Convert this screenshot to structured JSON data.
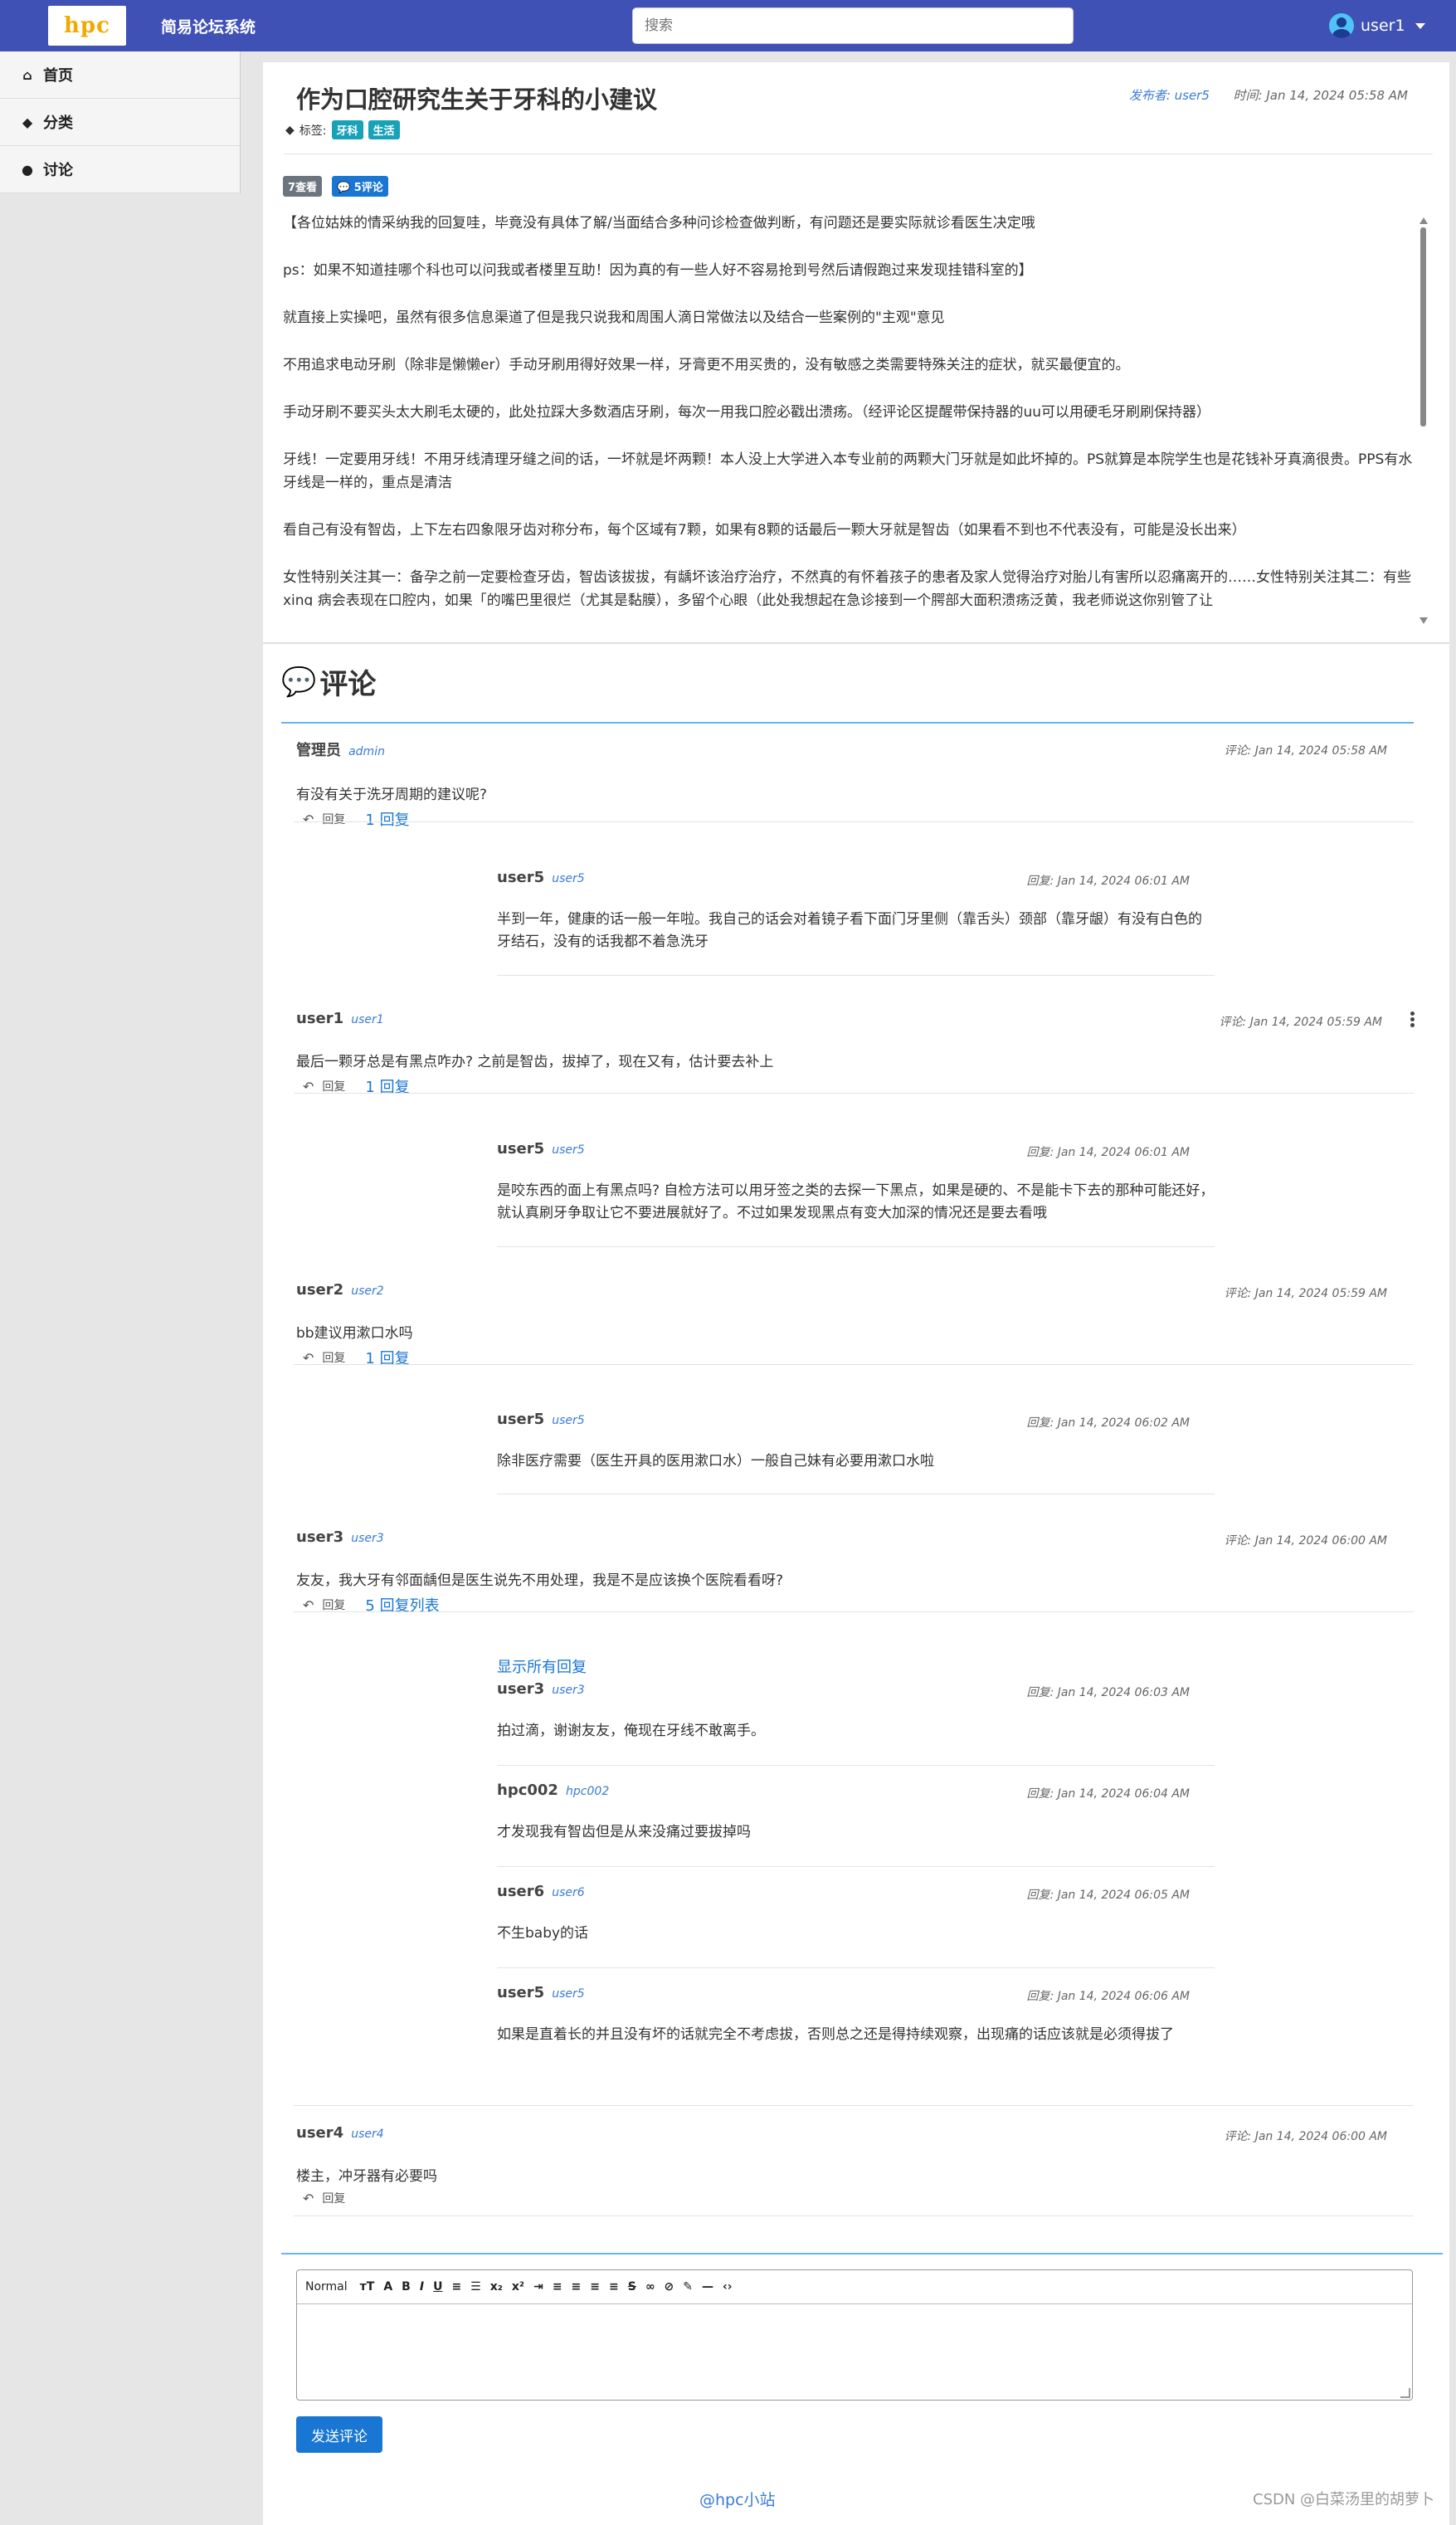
{
  "nav": {
    "logo_text": "hpc",
    "app_name": "简易论坛系统",
    "search_placeholder": "搜索",
    "user_name": "user1"
  },
  "sidebar": {
    "items": [
      {
        "label": "首页",
        "icon": "home-icon"
      },
      {
        "label": "分类",
        "icon": "tags-icon"
      },
      {
        "label": "讨论",
        "icon": "comment-icon"
      }
    ]
  },
  "post": {
    "title": "作为口腔研究生关于牙科的小建议",
    "publisher_label": "发布者: user5",
    "time_label": "时间: Jan 14, 2024 05:58 AM",
    "tags_label": "标签:",
    "tags": [
      "牙科",
      "生活"
    ],
    "views": "7查看",
    "comment_count": "5评论",
    "paragraphs": [
      "【各位姑妹的情采纳我的回复哇，毕竟没有具体了解/当面结合多种问诊检查做判断，有问题还是要实际就诊看医生决定哦",
      "ps：如果不知道挂哪个科也可以问我或者楼里互助！因为真的有一些人好不容易抢到号然后请假跑过来发现挂错科室的】",
      "就直接上实操吧，虽然有很多信息渠道了但是我只说我和周围人滴日常做法以及结合一些案例的\"主观\"意见",
      "不用追求电动牙刷（除非是懒懒er）手动牙刷用得好效果一样，牙膏更不用买贵的，没有敏感之类需要特殊关注的症状，就买最便宜的。",
      "手动牙刷不要买头太大刷毛太硬的，此处拉踩大多数酒店牙刷，每次一用我口腔必戳出溃疡。（经评论区提醒带保持器的uu可以用硬毛牙刷刷保持器）",
      "牙线！一定要用牙线！不用牙线清理牙缝之间的话，一坏就是坏两颗！本人没上大学进入本专业前的两颗大门牙就是如此坏掉的。PS就算是本院学生也是花钱补牙真滴很贵。PPS有水牙线是一样的，重点是清洁",
      "看自己有没有智齿，上下左右四象限牙齿对称分布，每个区域有7颗，如果有8颗的话最后一颗大牙就是智齿（如果看不到也不代表没有，可能是没长出来）",
      "女性特别关注其一：备孕之前一定要检查牙齿，智齿该拔拔，有龋坏该治疗治疗，不然真的有怀着孩子的患者及家人觉得治疗对胎儿有害所以忍痛离开的……女性特别关注其二：有些xing 病会表现在口腔内，如果「的嘴巴里很烂（尤其是黏膜），多留个心眼（此处我想起在急诊接到一个腭部大面积溃疡泛黄，我老师说这你别管了让"
    ]
  },
  "comments": {
    "heading": "评论",
    "time_prefix_top": "评论:",
    "reply_label": "回复",
    "items": [
      {
        "user": "管理员",
        "handle": "admin",
        "time": "评论: Jan 14, 2024 05:58 AM",
        "text": "有没有关于洗牙周期的建议呢?",
        "reply_count": "1 回复"
      },
      {
        "user": "user1",
        "handle": "user1",
        "time": "评论: Jan 14, 2024 05:59 AM",
        "text": "最后一颗牙总是有黑点咋办? 之前是智齿，拔掉了，现在又有，估计要去补上",
        "reply_count": "1 回复"
      },
      {
        "user": "user2",
        "handle": "user2",
        "time": "评论: Jan 14, 2024 05:59 AM",
        "text": "bb建议用漱口水吗",
        "reply_count": "1 回复"
      },
      {
        "user": "user3",
        "handle": "user3",
        "time": "评论: Jan 14, 2024 06:00 AM",
        "text": "友友，我大牙有邻面龋但是医生说先不用处理，我是不是应该换个医院看看呀?",
        "reply_count": "5 回复列表"
      },
      {
        "user": "user4",
        "handle": "user4",
        "time": "评论: Jan 14, 2024 06:00 AM",
        "text": "楼主，冲牙器有必要吗",
        "reply_count": ""
      }
    ],
    "replies": [
      {
        "user": "user5",
        "handle": "user5",
        "time": "回复: Jan 14, 2024 06:01 AM",
        "text": "半到一年，健康的话一般一年啦。我自己的话会对着镜子看下面门牙里侧（靠舌头）颈部（靠牙龈）有没有白色的牙结石，没有的话我都不着急洗牙"
      },
      {
        "user": "user5",
        "handle": "user5",
        "time": "回复: Jan 14, 2024 06:01 AM",
        "text": "是咬东西的面上有黑点吗? 自检方法可以用牙签之类的去探一下黑点，如果是硬的、不是能卡下去的那种可能还好，就认真刷牙争取让它不要进展就好了。不过如果发现黑点有变大加深的情况还是要去看哦"
      },
      {
        "user": "user5",
        "handle": "user5",
        "time": "回复: Jan 14, 2024 06:02 AM",
        "text": "除非医疗需要（医生开具的医用漱口水）一般自己妹有必要用漱口水啦"
      },
      {
        "user": "user3",
        "handle": "user3",
        "time": "回复: Jan 14, 2024 06:03 AM",
        "text": "拍过滴，谢谢友友，俺现在牙线不敢离手。"
      },
      {
        "user": "hpc002",
        "handle": "hpc002",
        "time": "回复: Jan 14, 2024 06:04 AM",
        "text": "才发现我有智齿但是从来没痛过要拔掉吗"
      },
      {
        "user": "user6",
        "handle": "user6",
        "time": "回复: Jan 14, 2024 06:05 AM",
        "text": "不生baby的话"
      },
      {
        "user": "user5",
        "handle": "user5",
        "time": "回复: Jan 14, 2024 06:06 AM",
        "text": "如果是直着长的并且没有坏的话就完全不考虑拔，否则总之还是得持续观察，出现痛的话应该就是必须得拔了"
      }
    ],
    "show_all": "显示所有回复"
  },
  "editor": {
    "format_label": "Normal",
    "submit_label": "发送评论"
  },
  "footer": {
    "link": "@hpc小站",
    "watermark": "CSDN @白菜汤里的胡萝卜"
  },
  "colors": {
    "nav_bg": "#3f51b5",
    "accent": "#1976d2",
    "tag_bg": "#17a2b8"
  }
}
